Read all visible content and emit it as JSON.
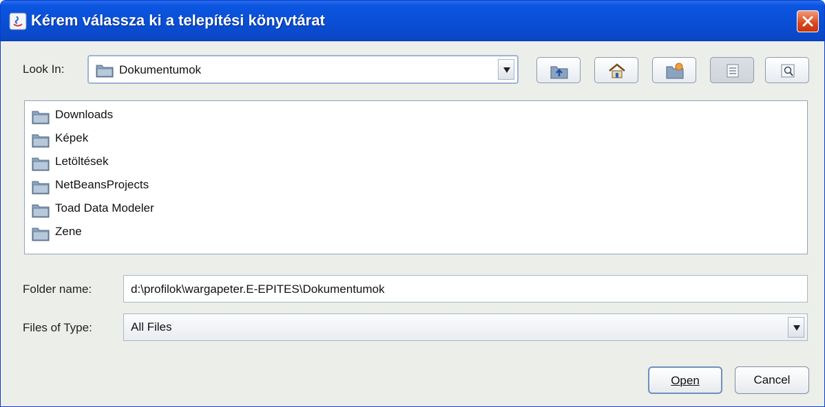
{
  "window": {
    "title": "Kérem válassza ki a telepítési könyvtárat"
  },
  "lookin": {
    "label": "Look In:",
    "value": "Dokumentumok"
  },
  "toolbar": {
    "buttons": [
      {
        "icon": "up-folder-icon"
      },
      {
        "icon": "home-icon"
      },
      {
        "icon": "new-folder-icon"
      },
      {
        "icon": "list-view-icon",
        "pressed": true
      },
      {
        "icon": "details-view-icon"
      }
    ]
  },
  "files": [
    {
      "name": "Downloads",
      "icon": "folder-icon"
    },
    {
      "name": "Képek",
      "icon": "folder-icon"
    },
    {
      "name": "Letöltések",
      "icon": "folder-icon"
    },
    {
      "name": "NetBeansProjects",
      "icon": "folder-icon"
    },
    {
      "name": "Toad Data Modeler",
      "icon": "folder-icon"
    },
    {
      "name": "Zene",
      "icon": "folder-icon"
    }
  ],
  "folder_name": {
    "label": "Folder name:",
    "value": "d:\\profilok\\wargapeter.E-EPITES\\Dokumentumok"
  },
  "file_type": {
    "label": "Files of Type:",
    "value": "All Files"
  },
  "actions": {
    "open_label": "Open",
    "cancel_label": "Cancel"
  },
  "colors": {
    "title_bar": "#0a4fd6",
    "close": "#d9471e",
    "dialog_bg": "#eceee9"
  }
}
